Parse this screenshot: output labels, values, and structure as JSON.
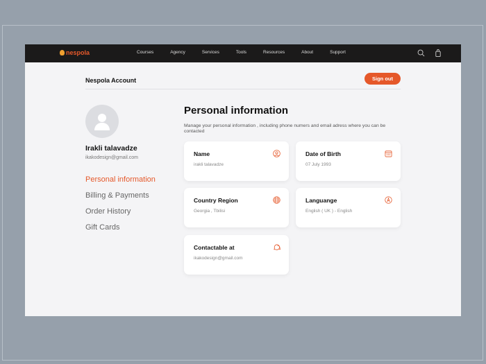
{
  "nav": {
    "logo": "nespola",
    "links": [
      "Courses",
      "Agency",
      "Services",
      "Tools",
      "Resources",
      "About",
      "Support"
    ]
  },
  "header": {
    "title": "Nespola Account",
    "sign_out": "Sign out"
  },
  "profile": {
    "name": "Irakli talavadze",
    "email": "ikakodesign@gmail.com"
  },
  "menu": [
    "Personal information",
    "Billing & Payments",
    "Order History",
    "Gift Cards"
  ],
  "main": {
    "title": "Personal information",
    "description": "Manage your personal information , including phone numers and email adress where you can be contacted",
    "cards": [
      {
        "label": "Name",
        "value": "irakli talavadze",
        "icon": "user-icon"
      },
      {
        "label": "Date of Birth",
        "value": "07 July 1993",
        "icon": "calendar-icon"
      },
      {
        "label": "Country Region",
        "value": "Georgia , Tbilisi",
        "icon": "globe-icon"
      },
      {
        "label": "Languange",
        "value": "English ( UK ) - English",
        "icon": "language-icon"
      },
      {
        "label": "Contactable at",
        "value": "ikakodesign@gmail.com",
        "icon": "chat-icon"
      }
    ]
  },
  "colors": {
    "accent": "#e5582a"
  }
}
